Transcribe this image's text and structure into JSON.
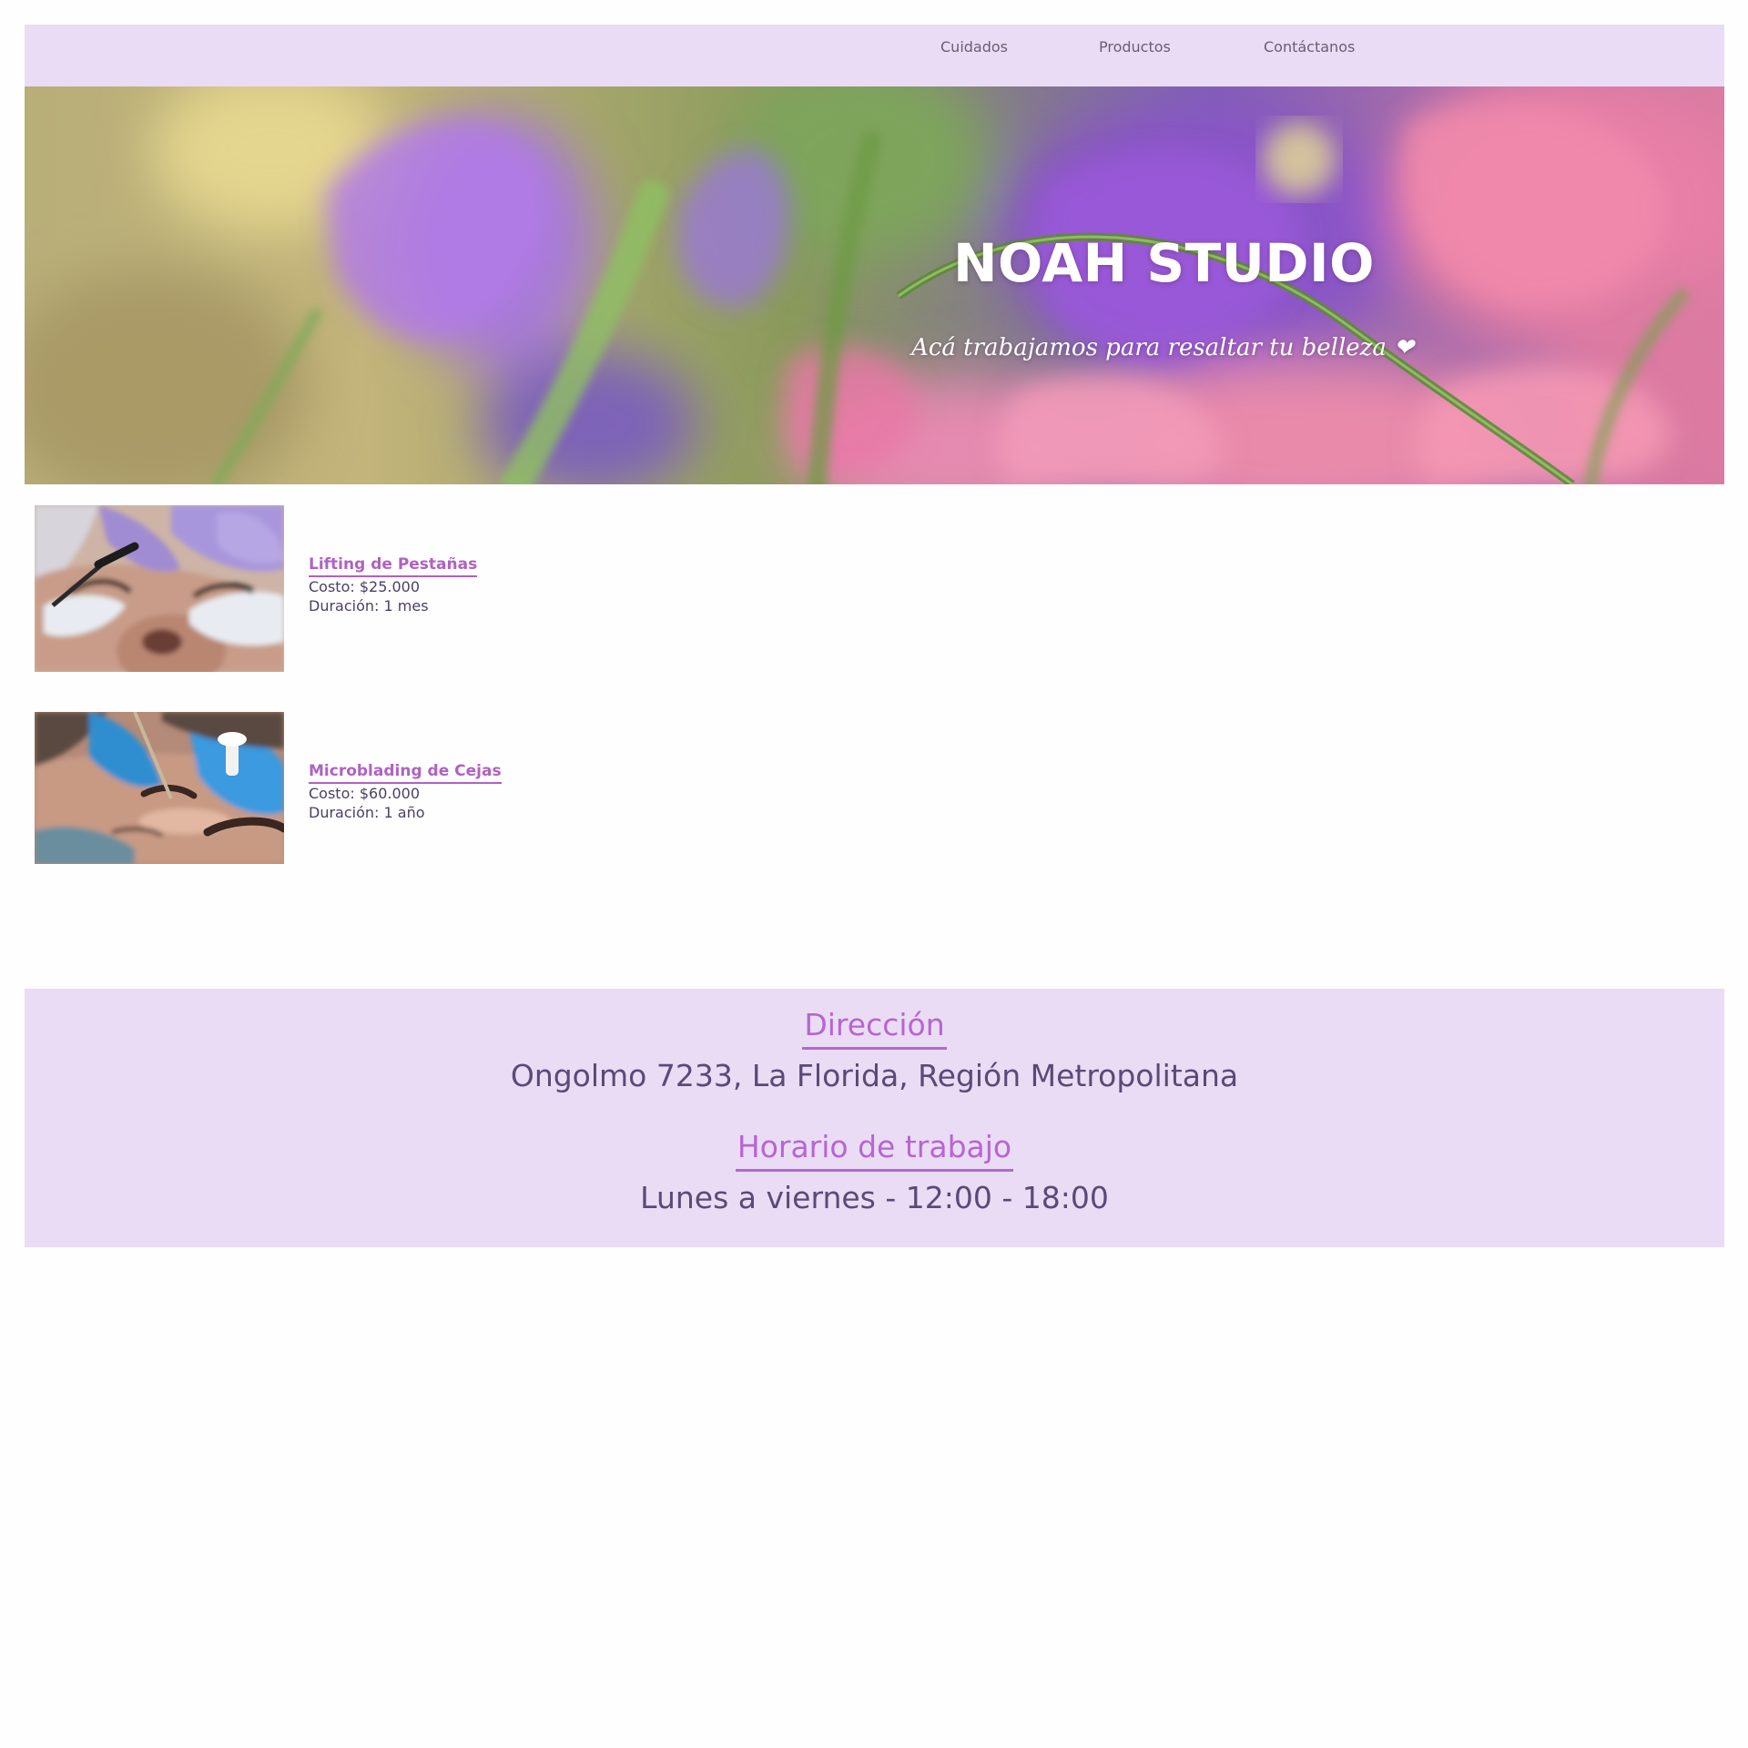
{
  "nav": {
    "items": [
      {
        "label": "Cuidados"
      },
      {
        "label": "Productos"
      },
      {
        "label": "Contáctanos"
      }
    ]
  },
  "hero": {
    "title": "NOAH STUDIO",
    "subtitle": "Acá trabajamos para resaltar tu belleza ❤"
  },
  "services": [
    {
      "name": "Lifting de Pestañas",
      "cost": "Costo: $25.000",
      "duration": "Duración: 1 mes"
    },
    {
      "name": "Microblading de Cejas",
      "cost": "Costo: $60.000",
      "duration": "Duración: 1 año"
    }
  ],
  "footer": {
    "address_heading": "Dirección",
    "address": "Ongolmo 7233, La Florida, Región Metropolitana",
    "hours_heading": "Horario de trabajo",
    "hours": "Lunes a viernes - 12:00 - 18:00"
  },
  "colors": {
    "nav_background": "#eadcf4",
    "accent": "#b061c3",
    "text_dark": "#4a3f66"
  }
}
